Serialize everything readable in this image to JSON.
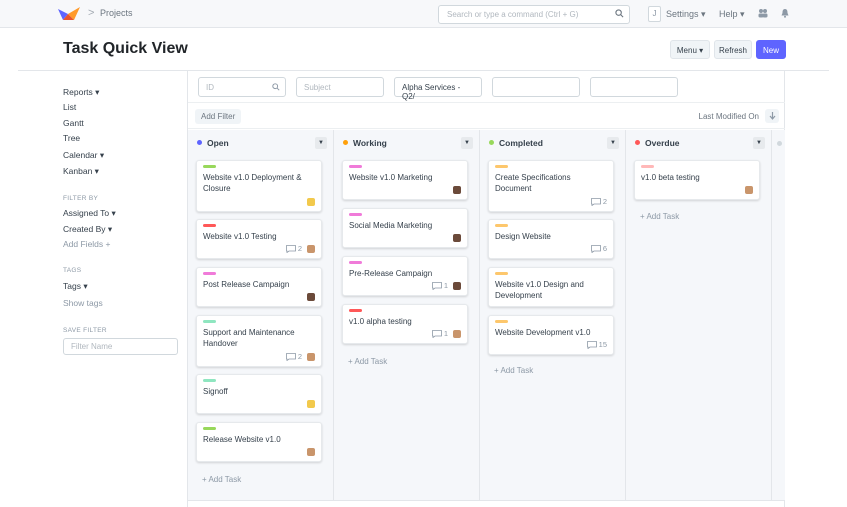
{
  "navbar": {
    "breadcrumb": "Projects",
    "breadcrumb_separator": ">",
    "search_placeholder": "Search or type a command (Ctrl + G)",
    "j_badge": "J",
    "settings": "Settings ▾",
    "help": "Help ▾"
  },
  "header": {
    "title": "Task Quick View",
    "menu_button": "Menu ▾",
    "refresh_button": "Refresh",
    "new_button": "New"
  },
  "sidebar": {
    "views": [
      "Reports ▾",
      "List",
      "Gantt",
      "Tree",
      "Calendar ▾",
      "Kanban ▾"
    ],
    "filter_by_heading": "FILTER BY",
    "filters": [
      "Assigned To ▾",
      "Created By ▾"
    ],
    "add_fields": "Add Fields +",
    "tags_heading": "TAGS",
    "tags": "Tags ▾",
    "show_tags": "Show tags",
    "save_filter_heading": "SAVE FILTER",
    "filter_name_placeholder": "Filter Name"
  },
  "filters": {
    "id_placeholder": "ID",
    "subject_placeholder": "Subject",
    "project_value": "Alpha Services - Q2/"
  },
  "sort": {
    "add_filter": "Add Filter",
    "sort_label": "Last Modified On"
  },
  "add_task_label": "+ Add Task",
  "columns": [
    {
      "title": "Open",
      "color": "#5e64ff",
      "cards": [
        {
          "title": "Website v1.0 Deployment & Closure",
          "tag_color": "#98d85b",
          "comments": "",
          "avatar": "yellow"
        },
        {
          "title": "Website v1.0 Testing",
          "tag_color": "#ff5858",
          "comments": "2",
          "avatar": "face"
        },
        {
          "title": "Post Release Campaign",
          "tag_color": "#f07bd9",
          "comments": "",
          "avatar": "dark"
        },
        {
          "title": "Support and Maintenance Handover",
          "tag_color": "#8fe6c0",
          "comments": "2",
          "avatar": "face"
        },
        {
          "title": "Signoff",
          "tag_color": "#8fe6c0",
          "comments": "",
          "avatar": "yellow"
        },
        {
          "title": "Release Website v1.0",
          "tag_color": "#98d85b",
          "comments": "",
          "avatar": "face"
        }
      ]
    },
    {
      "title": "Working",
      "color": "#ffa00a",
      "cards": [
        {
          "title": "Website v1.0 Marketing",
          "tag_color": "#f07bd9",
          "comments": "",
          "avatar": "dark"
        },
        {
          "title": "Social Media Marketing",
          "tag_color": "#f07bd9",
          "comments": "",
          "avatar": "dark"
        },
        {
          "title": "Pre-Release Campaign",
          "tag_color": "#f07bd9",
          "comments": "1",
          "avatar": "dark"
        },
        {
          "title": "v1.0 alpha testing",
          "tag_color": "#ff5858",
          "comments": "1",
          "avatar": "face"
        }
      ]
    },
    {
      "title": "Completed",
      "color": "#98d85b",
      "cards": [
        {
          "title": "Create Specifications Document",
          "tag_color": "#fdc76c",
          "comments": "2",
          "avatar": ""
        },
        {
          "title": "Design Website",
          "tag_color": "#fdc76c",
          "comments": "6",
          "avatar": ""
        },
        {
          "title": "Website v1.0 Design and Development",
          "tag_color": "#fdc76c",
          "comments": "",
          "avatar": ""
        },
        {
          "title": "Website Development v1.0",
          "tag_color": "#fdc76c",
          "comments": "15",
          "avatar": ""
        }
      ]
    },
    {
      "title": "Overdue",
      "color": "#ff5858",
      "cards": [
        {
          "title": "v1.0 beta testing",
          "tag_color": "#ffb8b8",
          "comments": "",
          "avatar": "face"
        }
      ]
    }
  ]
}
